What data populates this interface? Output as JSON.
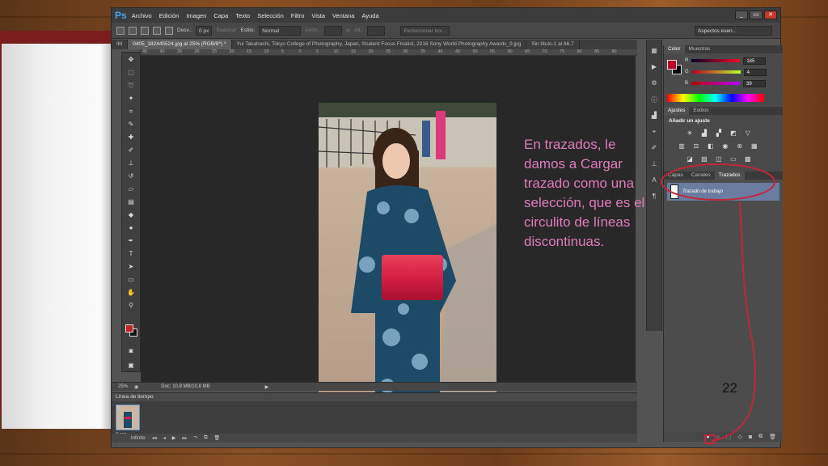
{
  "app": {
    "logo": "Ps",
    "menu": [
      "Archivo",
      "Edición",
      "Imagen",
      "Capa",
      "Texto",
      "Selección",
      "Filtro",
      "Vista",
      "Ventana",
      "Ayuda"
    ],
    "window_buttons": [
      "_",
      "▭",
      "✕"
    ]
  },
  "options_bar": {
    "feather_label": "Desv.:",
    "feather_value": "0 px",
    "smooth_label": "Suavizar",
    "style_label": "Estilo:",
    "style_value": "Normal",
    "width_label": "Anch.:",
    "height_label": "Alt.:",
    "refine_button": "Perfeccionar bor...",
    "workspace": "Aspectos esen..."
  },
  "doc_tabs": [
    {
      "label": "IM",
      "active": false
    },
    {
      "label": "0405_182445524.jpg al 25% (RGB/8*) *",
      "active": true
    },
    {
      "label": "Yui Takahashi, Tokyo College of Photography, Japan, Student Focus Finalist, 2016 Sony World Photography Awards_9.jpg",
      "active": false
    },
    {
      "label": "Sin título-1 al 66,7",
      "active": false
    }
  ],
  "ruler_ticks": [
    "45",
    "40",
    "35",
    "30",
    "25",
    "20",
    "15",
    "10",
    "5",
    "0",
    "5",
    "10",
    "15",
    "20",
    "25",
    "30",
    "35",
    "40",
    "45",
    "50",
    "55",
    "60",
    "65",
    "70",
    "75",
    "80",
    "85",
    "90"
  ],
  "annotation": "En trazados, le damos a Cargar trazado como una selección, que es el circulito de líneas discontinuas.",
  "status_bar": {
    "zoom": "25%",
    "doc_info": "Doc: 10,8 MB/10,8 MB"
  },
  "timeline": {
    "title": "Línea de tiempo",
    "frame_number": "1",
    "frame_time": "0 seg.",
    "loop": "Infinito"
  },
  "color_panel": {
    "tabs": [
      "Color",
      "Muestras"
    ],
    "channels": [
      {
        "label": "R",
        "value": "185"
      },
      {
        "label": "G",
        "value": "4"
      },
      {
        "label": "B",
        "value": "39"
      }
    ],
    "foreground_color": "#b90427"
  },
  "adjustments_panel": {
    "tabs": [
      "Ajustes",
      "Estilos"
    ],
    "title": "Añadir un ajuste"
  },
  "layers_panel": {
    "tabs": [
      "Capas",
      "Canales",
      "Trazados"
    ],
    "active_tab": "Trazados",
    "path_name": "Trazado de trabajo"
  },
  "slide_number": "22",
  "annotation_color": "#c0283a"
}
